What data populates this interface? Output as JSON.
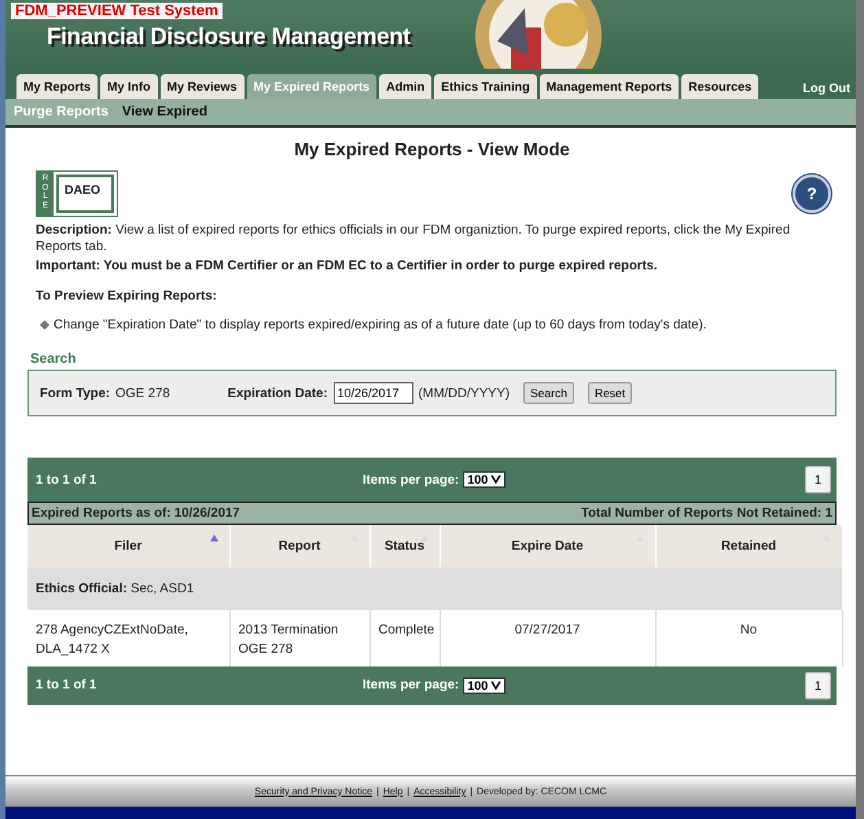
{
  "test_banner": "FDM_PREVIEW Test System",
  "app_title": "Financial Disclosure Management",
  "tabs": [
    {
      "label": "My Reports",
      "selected": false
    },
    {
      "label": "My Info",
      "selected": false
    },
    {
      "label": "My Reviews",
      "selected": false
    },
    {
      "label": "My Expired Reports",
      "selected": true
    },
    {
      "label": "Admin",
      "selected": false
    },
    {
      "label": "Ethics Training",
      "selected": false
    },
    {
      "label": "Management Reports",
      "selected": false
    },
    {
      "label": "Resources",
      "selected": false
    }
  ],
  "logout": "Log Out",
  "subnav": [
    {
      "label": "Purge Reports",
      "selected": false
    },
    {
      "label": "View Expired",
      "selected": true
    }
  ],
  "page_title": "My Expired Reports - View Mode",
  "role": {
    "label": "ROLE",
    "value": "DAEO"
  },
  "help": "?",
  "description": "**Description:** View a list of expired reports for ethics officials in our FDM organiztion. To purge expired reports, click the My Expired Reports tab.",
  "important": "Important: You must be a FDM Certifier or an FDM EC to a Certifier in order to purge expired reports.",
  "preview_heading": "To Preview Expiring Reports:",
  "preview_bullets": [
    "Change \"Expiration Date\" to display reports expired/expiring as of a future date (up to 60 days from today's date)."
  ],
  "search": {
    "heading": "Search",
    "form_type_label": "Form Type:",
    "form_type_value": "OGE 278",
    "date_label": "Expiration Date:",
    "date_value": "10/26/2017",
    "date_hint": "(MM/DD/YYYY)",
    "buttons": [
      "Search",
      "Reset"
    ]
  },
  "pager_top": {
    "range": "1 to 1 of 1",
    "items_label": "Items per page:",
    "items_value": "100",
    "page": "1"
  },
  "table": {
    "caption": "Expired Reports as of: 10/26/2017",
    "total": "Total Number of Reports Not Retained: 1",
    "columns": [
      {
        "label": "Filer",
        "sorted": true
      },
      {
        "label": "Report",
        "sorted": false
      },
      {
        "label": "Status",
        "sorted": false
      },
      {
        "label": "Expire Date",
        "sorted": false
      },
      {
        "label": "Retained",
        "sorted": false
      }
    ],
    "groups": [
      {
        "label": "Ethics Official:",
        "value": "Sec, ASD1",
        "rows": [
          [
            "278 AgencyCZExtNoDate, DLA_1472 X",
            "2013 Termination OGE 278",
            "Complete",
            "07/27/2017",
            "No"
          ]
        ]
      }
    ]
  },
  "pager_bottom": {
    "range": "1 to 1 of 1",
    "items_label": "Items per page:",
    "items_value": "100",
    "page": "1"
  },
  "footer": [
    {
      "text": "Security and Privacy Notice",
      "kind": "link"
    },
    {
      "text": "|",
      "kind": "separator"
    },
    {
      "text": "Help",
      "kind": "link"
    },
    {
      "text": "|",
      "kind": "separator"
    },
    {
      "text": "Accessibility",
      "kind": "link"
    },
    {
      "text": "|",
      "kind": "separator"
    },
    {
      "text": "Developed by: CECOM LCMC",
      "kind": "text"
    }
  ]
}
